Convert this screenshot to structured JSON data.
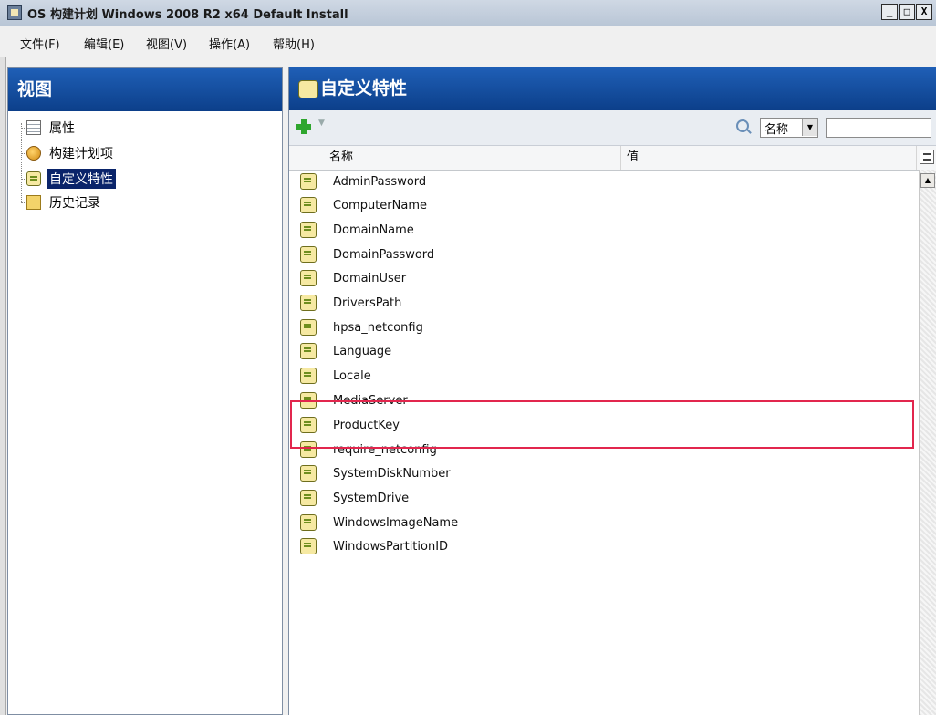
{
  "window": {
    "title": "OS 构建计划 Windows 2008 R2 x64 Default Install",
    "buttons": [
      "_",
      "□",
      "X"
    ]
  },
  "menu": [
    "文件(F)",
    "编辑(E)",
    "视图(V)",
    "操作(A)",
    "帮助(H)"
  ],
  "left_pane": {
    "header": "视图",
    "items": [
      {
        "label": "属性",
        "icon": "properties-icon"
      },
      {
        "label": "构建计划项",
        "icon": "build-plan-icon"
      },
      {
        "label": "自定义特性",
        "icon": "custom-attribute-icon",
        "selected": true
      },
      {
        "label": "历史记录",
        "icon": "history-icon"
      }
    ]
  },
  "right_pane": {
    "header": "自定义特性",
    "search": {
      "field": "名称",
      "value": ""
    },
    "columns": [
      "名称",
      "值"
    ],
    "rows": [
      "AdminPassword",
      "ComputerName",
      "DomainName",
      "DomainPassword",
      "DomainUser",
      "DriversPath",
      "hpsa_netconfig",
      "Language",
      "Locale",
      "MediaServer",
      "ProductKey",
      "require_netconfig",
      "SystemDiskNumber",
      "SystemDrive",
      "WindowsImageName",
      "WindowsPartitionID"
    ]
  },
  "colors": {
    "header_blue": "#1f5fb6",
    "selection": "#0a246a",
    "highlight_box": "#e2264d"
  }
}
